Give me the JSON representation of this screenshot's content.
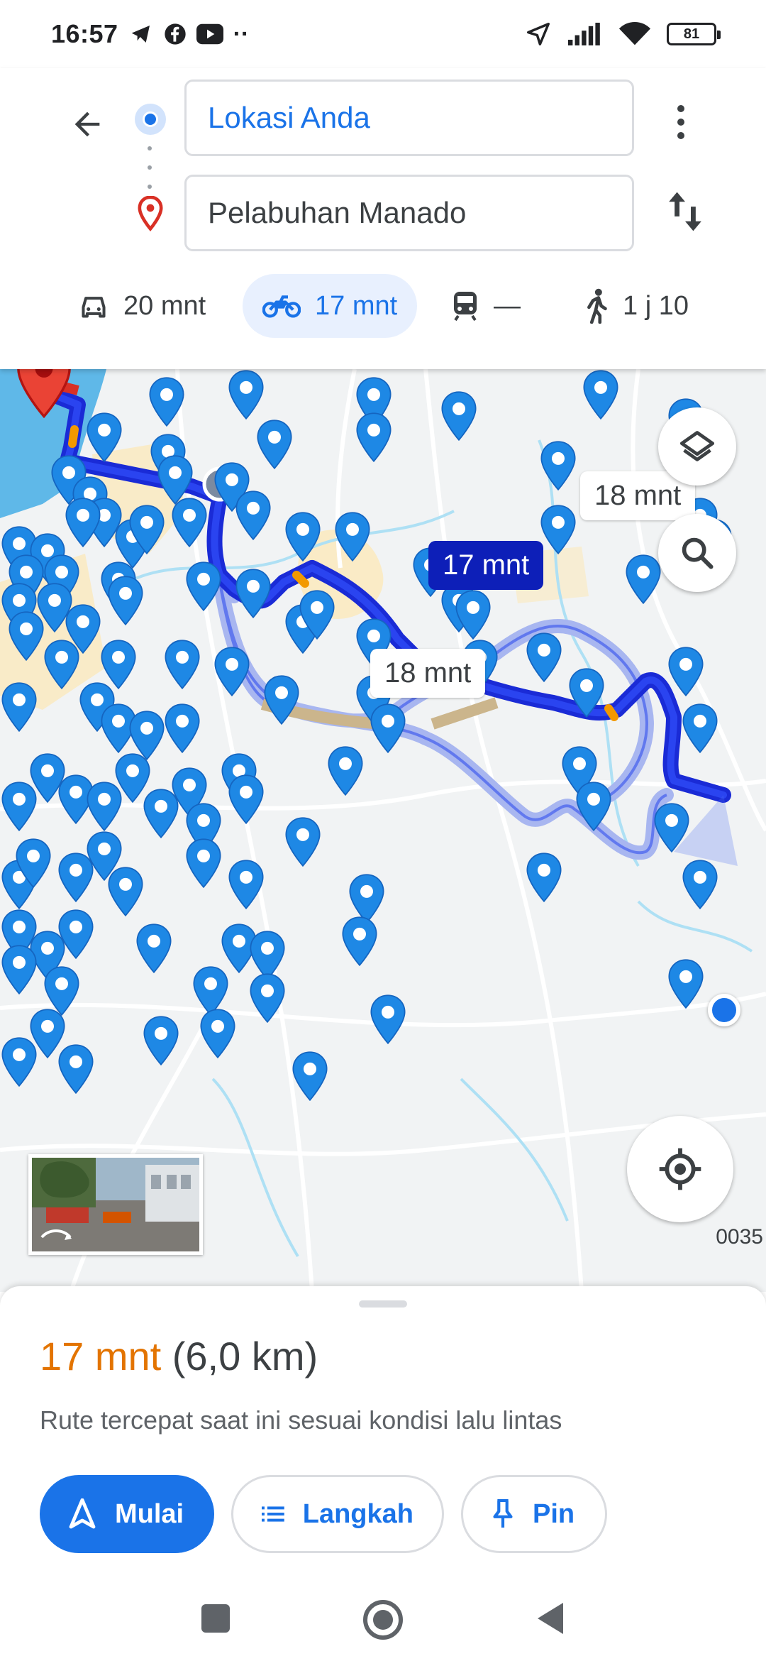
{
  "status_bar": {
    "time": "16:57",
    "icons_left": [
      "telegram-icon",
      "facebook-icon",
      "youtube-icon",
      "more-dots"
    ],
    "dots": "··",
    "icons_right": [
      "location-arrow-icon",
      "signal-icon",
      "wifi-icon",
      "battery-icon"
    ],
    "battery": "81"
  },
  "route_header": {
    "origin": "Lokasi Anda",
    "destination": "Pelabuhan Manado"
  },
  "travel_modes": [
    {
      "name": "car",
      "label": "20 mnt"
    },
    {
      "name": "motorcycle",
      "label": "17 mnt",
      "selected": true
    },
    {
      "name": "transit",
      "label": "—"
    },
    {
      "name": "walk",
      "label": "1 j 10"
    }
  ],
  "map": {
    "route_labels": {
      "alt_top": "18 mnt",
      "selected": "17 mnt",
      "alt_bottom": "18 mnt"
    },
    "edge_code": "0035",
    "colors": {
      "route_selected": "#1a2bd6",
      "route_alt": "#a8b6f0",
      "pin": "#1e88e5",
      "destination_pin": "#ea4335",
      "water": "#5fb8e8"
    }
  },
  "bottom_sheet": {
    "duration": "17 mnt",
    "distance": "(6,0 km)",
    "description": "Rute tercepat saat ini sesuai kondisi lalu lintas",
    "buttons": {
      "start": "Mulai",
      "steps": "Langkah",
      "pin": "Pin"
    }
  }
}
